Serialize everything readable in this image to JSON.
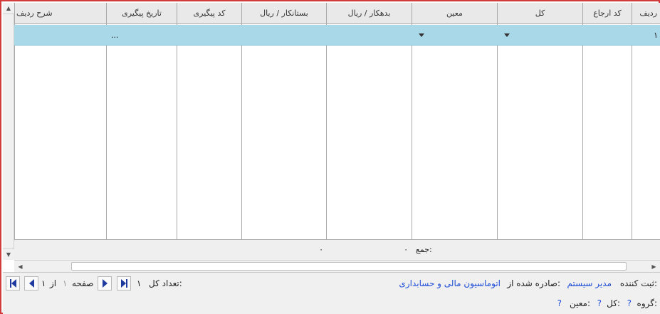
{
  "grid": {
    "headers": {
      "row_no": "ردیف",
      "ref_code": "کد ارجاع",
      "kol": "کل",
      "moein": "معین",
      "debit": "بدهکار / ریال",
      "credit": "بستانکار / ریال",
      "tracking_code": "کد پیگیری",
      "tracking_date": "تاریخ پیگیری",
      "row_desc": "شرح ردیف"
    },
    "selected_row": {
      "row_no": "۱",
      "tracking_date": "..."
    },
    "footer": {
      "sum_label": "جمع:",
      "debit_total": "۰",
      "credit_total": "۰"
    }
  },
  "panel": {
    "recorder_label": "ثبت کننده:",
    "recorder_value": "مدیر سیستم",
    "issued_label": "صادره شده از:",
    "issued_value": "اتوماسیون مالی و حسابداری",
    "total_count_label": "تعداد کل:",
    "total_count_value": "۱",
    "page_label": "صفحه",
    "page_current": "۱",
    "page_of_label": "از",
    "page_total": "۱",
    "group_label": "گروه:",
    "group_value": "?",
    "kol_label": "کل:",
    "kol_value": "?",
    "moein_label": "معین:",
    "moein_value": "?"
  },
  "colors": {
    "selected_row": "#a9d8e8",
    "frame_border": "#d23b3b",
    "link_blue": "#1f4fd6",
    "nav_blue": "#1f3a9e"
  },
  "icons": {
    "scroll_up": "triangle-up-icon",
    "scroll_down": "triangle-down-icon",
    "scroll_left": "triangle-left-icon",
    "scroll_right": "triangle-right-icon",
    "dropdown": "chevron-down-icon",
    "first_page": "first-page-icon",
    "prev_page": "prev-page-icon",
    "next_page": "next-page-icon",
    "last_page": "last-page-icon"
  }
}
